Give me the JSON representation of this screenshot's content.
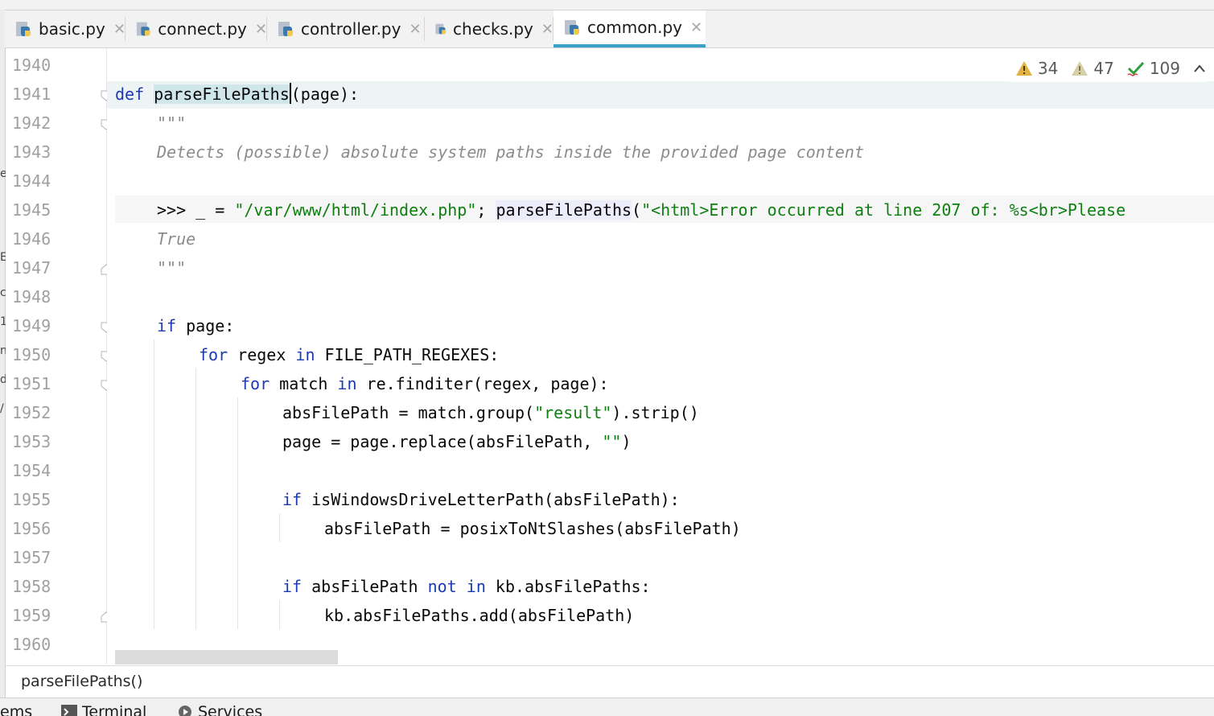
{
  "tabs": [
    {
      "label": "basic.py",
      "active": false
    },
    {
      "label": "connect.py",
      "active": false
    },
    {
      "label": "controller.py",
      "active": false
    },
    {
      "label": "checks.py",
      "active": false
    },
    {
      "label": "common.py",
      "active": true
    }
  ],
  "tab_close_glyph": "✕",
  "inspection": {
    "warnings": "34",
    "weak_warnings": "47",
    "typos": "109",
    "warning_color": "#e3b341",
    "weak_warning_color": "#c9c19a",
    "typo_color": "#2e9e3f"
  },
  "line_numbers": [
    "1940",
    "1941",
    "1942",
    "1943",
    "1944",
    "1945",
    "1946",
    "1947",
    "1948",
    "1949",
    "1950",
    "1951",
    "1952",
    "1953",
    "1954",
    "1955",
    "1956",
    "1957",
    "1958",
    "1959",
    "1960"
  ],
  "code": {
    "l1941_def": "def",
    "l1941_name": "parseFilePaths",
    "l1941_rest": "(page):",
    "l1942": "\"\"\"",
    "l1943": "Detects (possible) absolute system paths inside the provided page content",
    "l1945_a": ">>> _ = ",
    "l1945_s1": "\"/var/www/html/index.php\"",
    "l1945_b": "; ",
    "l1945_call": "parseFilePaths",
    "l1945_c": "(",
    "l1945_s2": "\"<html>Error occurred at line 207 of: %s<br>Please",
    "l1946": "True",
    "l1947": "\"\"\"",
    "l1949_kw": "if",
    "l1949_rest": " page:",
    "l1950_kw": "for",
    "l1950_a": " regex ",
    "l1950_kw2": "in",
    "l1950_b": " FILE_PATH_REGEXES:",
    "l1951_kw": "for",
    "l1951_a": " match ",
    "l1951_kw2": "in",
    "l1951_b": " re.finditer(regex, page):",
    "l1952_a": "absFilePath = match.group(",
    "l1952_s": "\"result\"",
    "l1952_b": ").strip()",
    "l1953_a": "page = page.replace(absFilePath, ",
    "l1953_s": "\"\"",
    "l1953_b": ")",
    "l1955_kw": "if",
    "l1955_rest": " isWindowsDriveLetterPath(absFilePath):",
    "l1956": "absFilePath = posixToNtSlashes(absFilePath)",
    "l1958_kw": "if",
    "l1958_a": " absFilePath ",
    "l1958_kw2": "not in",
    "l1958_b": " kb.absFilePaths:",
    "l1959": "kb.absFilePaths.add(absFilePath)"
  },
  "breadcrumb": "parseFilePaths()",
  "bottom_tools": [
    {
      "label": "ems",
      "icon": "problems-icon"
    },
    {
      "label": "Terminal",
      "icon": "terminal-icon"
    },
    {
      "label": "Services",
      "icon": "services-icon"
    }
  ],
  "left_strip_chars": [
    "e",
    "E",
    "c",
    "1",
    "n",
    "d",
    "/"
  ]
}
